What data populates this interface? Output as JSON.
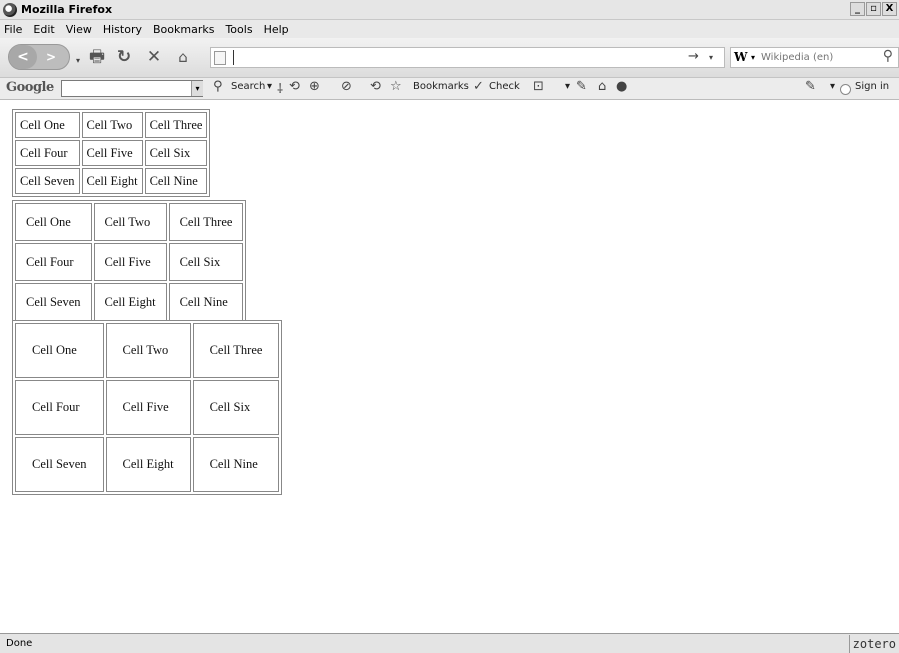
{
  "window": {
    "title": "Mozilla Firefox",
    "controls": [
      "_",
      "▫",
      "X"
    ]
  },
  "menubar": {
    "items": [
      "File",
      "Edit",
      "View",
      "History",
      "Bookmarks",
      "Tools",
      "Help"
    ]
  },
  "navbar": {
    "url_value": "",
    "search_engine_letter": "W",
    "search_placeholder": "Wikipedia (en)"
  },
  "google_toolbar": {
    "logo": "Google",
    "search_label": "Search",
    "bookmarks_label": "Bookmarks",
    "check_label": "Check",
    "sign_in_label": "Sign in"
  },
  "tables": [
    [
      [
        "Cell One",
        "Cell Two",
        "Cell Three"
      ],
      [
        "Cell Four",
        "Cell Five",
        "Cell Six"
      ],
      [
        "Cell Seven",
        "Cell Eight",
        "Cell Nine"
      ]
    ],
    [
      [
        "Cell One",
        "Cell Two",
        "Cell Three"
      ],
      [
        "Cell Four",
        "Cell Five",
        "Cell Six"
      ],
      [
        "Cell Seven",
        "Cell Eight",
        "Cell Nine"
      ]
    ],
    [
      [
        "Cell One",
        "Cell Two",
        "Cell Three"
      ],
      [
        "Cell Four",
        "Cell Five",
        "Cell Six"
      ],
      [
        "Cell Seven",
        "Cell Eight",
        "Cell Nine"
      ]
    ]
  ],
  "statusbar": {
    "text": "Done",
    "zotero_label": "zotero"
  }
}
